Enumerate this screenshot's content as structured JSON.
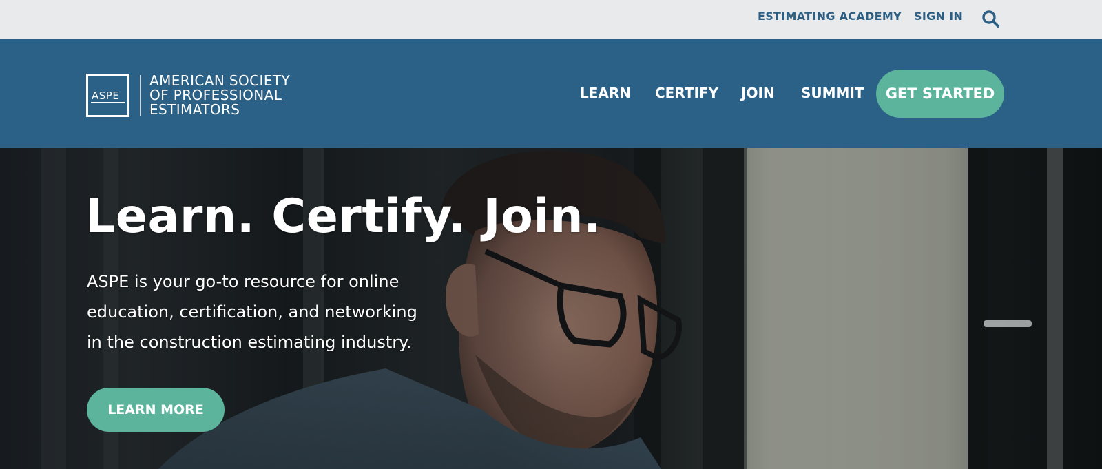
{
  "utility_nav": {
    "links": [
      {
        "label": "ESTIMATING ACADEMY"
      },
      {
        "label": "SIGN IN"
      }
    ],
    "search_icon": "search-icon"
  },
  "header": {
    "logo": {
      "box_text": "ASPE",
      "lines": [
        "AMERICAN SOCIETY",
        "OF PROFESSIONAL",
        "ESTIMATORS"
      ]
    },
    "nav": [
      {
        "label": "LEARN"
      },
      {
        "label": "CERTIFY"
      },
      {
        "label": "JOIN"
      },
      {
        "label": "SUMMIT"
      }
    ],
    "cta_label": "GET STARTED"
  },
  "hero": {
    "title": "Learn. Certify. Join.",
    "lines": [
      "ASPE is your go-to resource for online",
      "education, certification, and networking",
      "in the construction estimating industry."
    ],
    "button_label": "LEARN MORE"
  },
  "colors": {
    "utility_bg": "#e9eaec",
    "brand_blue": "#2b6187",
    "utility_link": "#2c5f83",
    "accent_green": "#5bb49b"
  }
}
